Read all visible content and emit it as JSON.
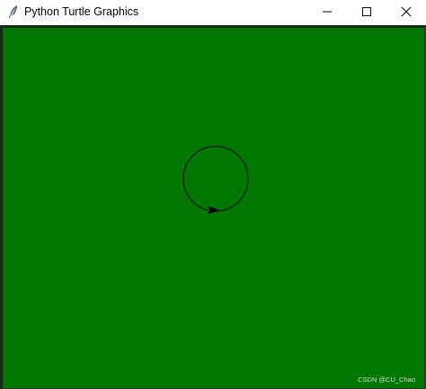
{
  "window": {
    "title": "Python Turtle Graphics",
    "app_icon": "feather-icon",
    "controls": {
      "minimize_icon": "minimize-icon",
      "maximize_icon": "maximize-icon",
      "close_icon": "close-icon"
    }
  },
  "canvas": {
    "background_color": "#007700",
    "pen_color": "#000000",
    "shapes": [
      "circle",
      "turtle-arrow"
    ]
  },
  "watermark": {
    "text": "CSDN @CU_Chao"
  }
}
